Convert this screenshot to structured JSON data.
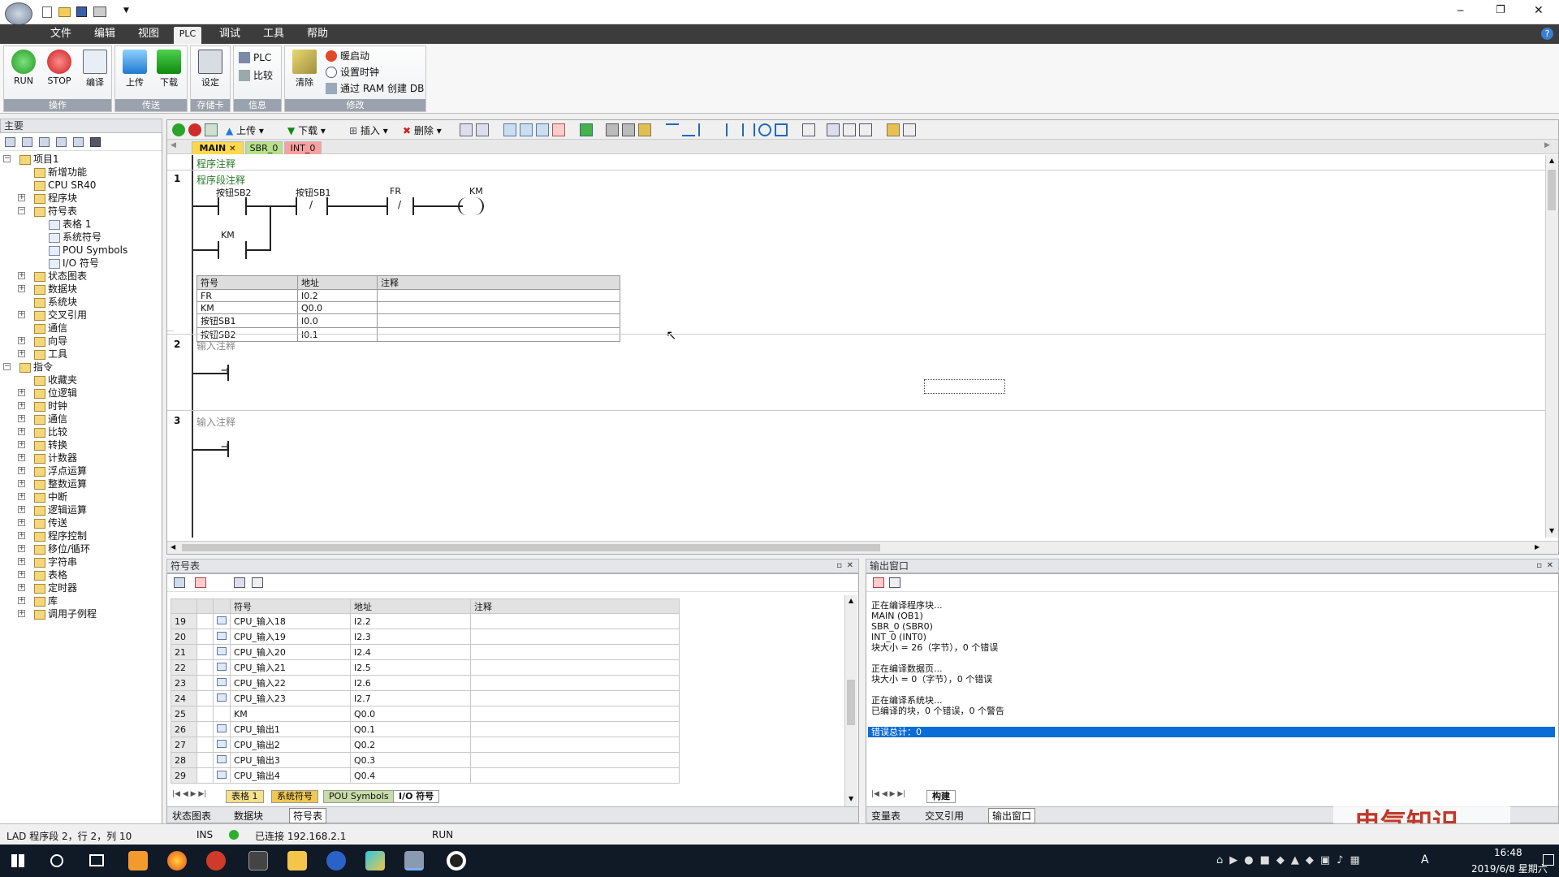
{
  "window": {
    "minimize": "─",
    "restore": "❐",
    "close": "✕",
    "help": "?"
  },
  "menu": {
    "items": [
      "文件",
      "编辑",
      "视图",
      "PLC",
      "调试",
      "工具",
      "帮助"
    ],
    "active": "PLC"
  },
  "ribbon": {
    "groups": [
      {
        "label": "操作",
        "buttons": [
          "RUN",
          "STOP",
          "编译"
        ]
      },
      {
        "label": "传送",
        "buttons": [
          "上传",
          "下载"
        ]
      },
      {
        "label": "存储卡",
        "buttons": [
          "设定"
        ]
      },
      {
        "label": "信息",
        "buttons": [
          "PLC",
          "比较"
        ]
      },
      {
        "label": "修改",
        "buttons": [
          "清除",
          "暖启动",
          "设置时钟",
          "通过 RAM 创建 DB"
        ]
      }
    ]
  },
  "left_panel": {
    "title": "主要",
    "tree": [
      {
        "label": "项目1",
        "level": 0,
        "exp": "−"
      },
      {
        "label": "新增功能",
        "level": 1
      },
      {
        "label": "CPU SR40",
        "level": 1
      },
      {
        "label": "程序块",
        "level": 1,
        "exp": "+"
      },
      {
        "label": "符号表",
        "level": 1,
        "exp": "−"
      },
      {
        "label": "表格 1",
        "level": 2
      },
      {
        "label": "系统符号",
        "level": 2
      },
      {
        "label": "POU Symbols",
        "level": 2
      },
      {
        "label": "I/O 符号",
        "level": 2
      },
      {
        "label": "状态图表",
        "level": 1,
        "exp": "+"
      },
      {
        "label": "数据块",
        "level": 1,
        "exp": "+"
      },
      {
        "label": "系统块",
        "level": 1
      },
      {
        "label": "交叉引用",
        "level": 1,
        "exp": "+"
      },
      {
        "label": "通信",
        "level": 1
      },
      {
        "label": "向导",
        "level": 1,
        "exp": "+"
      },
      {
        "label": "工具",
        "level": 1,
        "exp": "+"
      },
      {
        "label": "指令",
        "level": 0,
        "exp": "−"
      },
      {
        "label": "收藏夹",
        "level": 1
      },
      {
        "label": "位逻辑",
        "level": 1,
        "exp": "+"
      },
      {
        "label": "时钟",
        "level": 1,
        "exp": "+"
      },
      {
        "label": "通信",
        "level": 1,
        "exp": "+"
      },
      {
        "label": "比较",
        "level": 1,
        "exp": "+"
      },
      {
        "label": "转换",
        "level": 1,
        "exp": "+"
      },
      {
        "label": "计数器",
        "level": 1,
        "exp": "+"
      },
      {
        "label": "浮点运算",
        "level": 1,
        "exp": "+"
      },
      {
        "label": "整数运算",
        "level": 1,
        "exp": "+"
      },
      {
        "label": "中断",
        "level": 1,
        "exp": "+"
      },
      {
        "label": "逻辑运算",
        "level": 1,
        "exp": "+"
      },
      {
        "label": "传送",
        "level": 1,
        "exp": "+"
      },
      {
        "label": "程序控制",
        "level": 1,
        "exp": "+"
      },
      {
        "label": "移位/循环",
        "level": 1,
        "exp": "+"
      },
      {
        "label": "字符串",
        "level": 1,
        "exp": "+"
      },
      {
        "label": "表格",
        "level": 1,
        "exp": "+"
      },
      {
        "label": "定时器",
        "level": 1,
        "exp": "+"
      },
      {
        "label": "库",
        "level": 1,
        "exp": "+"
      },
      {
        "label": "调用子例程",
        "level": 1,
        "exp": "+"
      }
    ]
  },
  "editor": {
    "toolbar": {
      "upload": "上传",
      "download": "下载",
      "insert": "插入",
      "delete": "删除"
    },
    "tabs": [
      {
        "label": "MAIN",
        "close": "✕"
      },
      {
        "label": "SBR_0"
      },
      {
        "label": "INT_0"
      }
    ],
    "program_comment": "程序注释",
    "networks": [
      {
        "num": "1",
        "comment": "程序段注释",
        "contacts": [
          "按钮SB2",
          "按钮SB1",
          "FR",
          "KM"
        ],
        "branch": "KM",
        "symbols": {
          "header": [
            "符号",
            "地址",
            "注释"
          ],
          "rows": [
            [
              "FR",
              "I0.2",
              ""
            ],
            [
              "KM",
              "Q0.0",
              ""
            ],
            [
              "按钮SB1",
              "I0.0",
              ""
            ],
            [
              "按钮SB2",
              "I0.1",
              ""
            ]
          ]
        }
      },
      {
        "num": "2",
        "comment": "输入注释"
      },
      {
        "num": "3",
        "comment": "输入注释"
      }
    ]
  },
  "symbol_table": {
    "title": "符号表",
    "header": [
      "符号",
      "地址",
      "注释"
    ],
    "rows": [
      [
        "19",
        "CPU_输入18",
        "I2.2"
      ],
      [
        "20",
        "CPU_输入19",
        "I2.3"
      ],
      [
        "21",
        "CPU_输入20",
        "I2.4"
      ],
      [
        "22",
        "CPU_输入21",
        "I2.5"
      ],
      [
        "23",
        "CPU_输入22",
        "I2.6"
      ],
      [
        "24",
        "CPU_输入23",
        "I2.7"
      ],
      [
        "25",
        "KM",
        "Q0.0"
      ],
      [
        "26",
        "CPU_输出1",
        "Q0.1"
      ],
      [
        "27",
        "CPU_输出2",
        "Q0.2"
      ],
      [
        "28",
        "CPU_输出3",
        "Q0.3"
      ],
      [
        "29",
        "CPU_输出4",
        "Q0.4"
      ]
    ],
    "tabs": [
      "表格 1",
      "系统符号",
      "POU Symbols",
      "I/O 符号"
    ]
  },
  "output_window": {
    "title": "输出窗口",
    "lines": [
      "正在编译程序块...",
      "MAIN (OB1)",
      "SBR_0 (SBR0)",
      "INT_0 (INT0)",
      "块大小 = 26（字节），0 个错误",
      "",
      "正在编译数据页...",
      "块大小 = 0（字节），0 个错误",
      "",
      "正在编译系统块...",
      "已编译的块，0 个错误，0 个警告",
      "",
      "错误总计：0"
    ],
    "tab": "构建"
  },
  "bottom_tabs": {
    "left": [
      "状态图表",
      "数据块",
      "符号表"
    ],
    "right": [
      "变量表",
      "交叉引用",
      "输出窗口"
    ]
  },
  "status": {
    "position": "LAD 程序段 2，行 2，列 10",
    "mode": "INS",
    "connection": "已连接 192.168.2.1",
    "run": "RUN"
  },
  "watermark": "电气知识",
  "taskbar": {
    "time": "16:48",
    "date": "2019/6/8 星期六",
    "lang": "A"
  }
}
